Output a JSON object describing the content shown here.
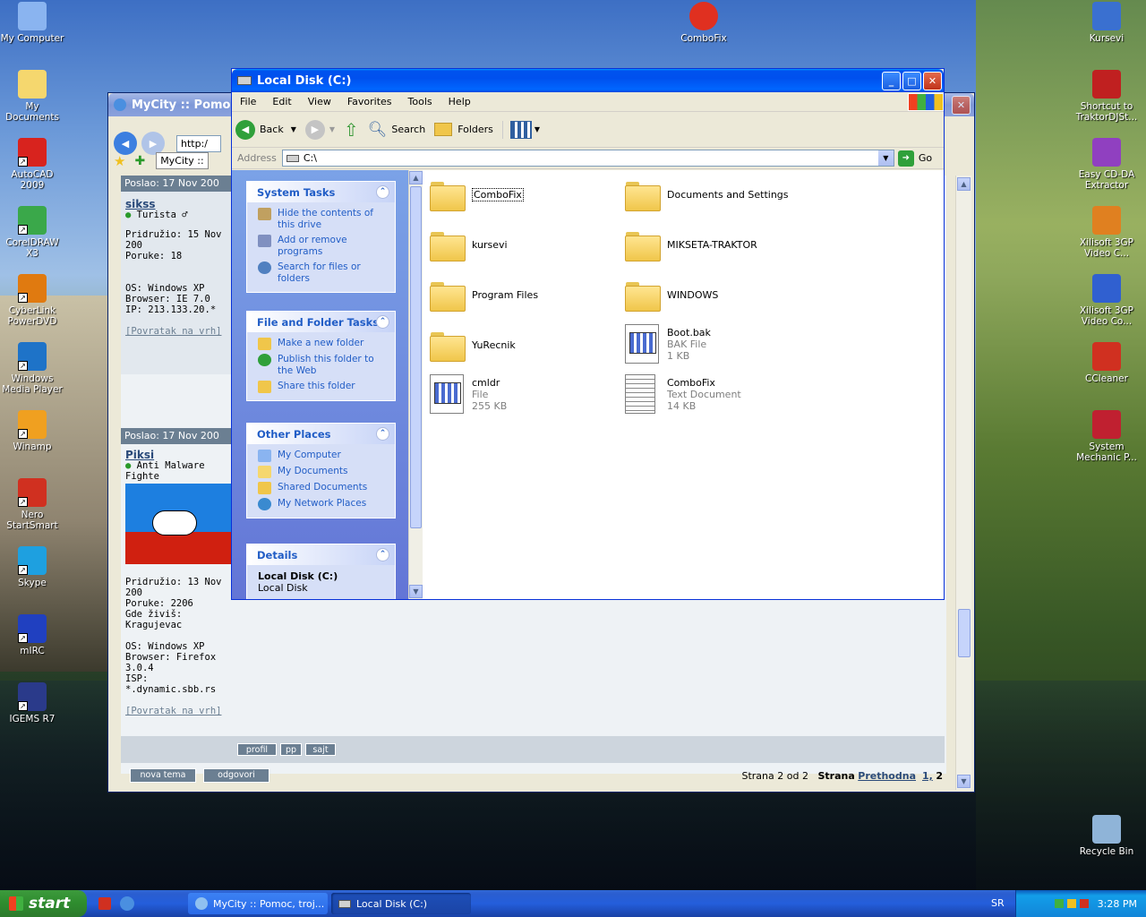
{
  "desktop": {
    "left_icons": [
      {
        "label": "My Computer",
        "icon": "computer-icon",
        "color": "#8ab4f0"
      },
      {
        "label": "My Documents",
        "icon": "documents-folder-icon",
        "color": "#f5d76e"
      },
      {
        "label": "AutoCAD 2009",
        "icon": "autocad-icon",
        "color": "#d8231e"
      },
      {
        "label": "CorelDRAW X3",
        "icon": "coreldraw-icon",
        "color": "#3aa84a"
      },
      {
        "label": "CyberLink PowerDVD",
        "icon": "powerdvd-icon",
        "color": "#e07a10"
      },
      {
        "label": "Windows Media Player",
        "icon": "media-player-icon",
        "color": "#1e73c8"
      },
      {
        "label": "Winamp",
        "icon": "winamp-icon",
        "color": "#f0a020"
      },
      {
        "label": "Nero StartSmart",
        "icon": "nero-icon",
        "color": "#d03020"
      },
      {
        "label": "Skype",
        "icon": "skype-icon",
        "color": "#1ea0e0"
      },
      {
        "label": "mIRC",
        "icon": "mirc-icon",
        "color": "#2040c0"
      },
      {
        "label": "IGEMS R7",
        "icon": "igems-icon",
        "color": "#2a3a8a"
      }
    ],
    "right_icons": [
      {
        "label": "Kursevi",
        "icon": "kursevi-icon",
        "color": "#3a70d0"
      },
      {
        "label": "Shortcut to TraktorDJSt...",
        "icon": "traktor-icon",
        "color": "#c02020"
      },
      {
        "label": "Easy CD-DA Extractor",
        "icon": "cd-extractor-icon",
        "color": "#9040c0"
      },
      {
        "label": "Xilisoft 3GP Video C...",
        "icon": "xilisoft-icon",
        "color": "#e08020"
      },
      {
        "label": "Xilisoft 3GP Video Co...",
        "icon": "xilisoft-icon-2",
        "color": "#3060d0"
      },
      {
        "label": "CCleaner",
        "icon": "ccleaner-icon",
        "color": "#d03020"
      },
      {
        "label": "System Mechanic P...",
        "icon": "system-mechanic-icon",
        "color": "#c02030"
      },
      {
        "label": "Recycle Bin",
        "icon": "recycle-bin-icon",
        "color": "#8fb4d8"
      }
    ],
    "top_icon": {
      "label": "ComboFix",
      "icon": "combofix-icon",
      "color": "#e03020"
    }
  },
  "explorer": {
    "title": "Local Disk (C:)",
    "menu": [
      "File",
      "Edit",
      "View",
      "Favorites",
      "Tools",
      "Help"
    ],
    "toolbar": {
      "back": "Back",
      "search": "Search",
      "folders": "Folders"
    },
    "address_label": "Address",
    "address_value": "C:\\",
    "go_label": "Go",
    "tasks": {
      "system": {
        "title": "System Tasks",
        "items": [
          "Hide the contents of this drive",
          "Add or remove programs",
          "Search for files or folders"
        ]
      },
      "file_folder": {
        "title": "File and Folder Tasks",
        "items": [
          "Make a new folder",
          "Publish this folder to the Web",
          "Share this folder"
        ]
      },
      "other": {
        "title": "Other Places",
        "items": [
          "My Computer",
          "My Documents",
          "Shared Documents",
          "My Network Places"
        ]
      },
      "details": {
        "title": "Details",
        "name": "Local Disk (C:)",
        "type": "Local Disk"
      }
    },
    "files": [
      {
        "name": "ComboFix"
      },
      {
        "name": "Documents and Settings"
      },
      {
        "name": "kursevi"
      },
      {
        "name": "MIKSETA-TRAKTOR"
      },
      {
        "name": "Program Files"
      },
      {
        "name": "WINDOWS"
      },
      {
        "name": "YuRecnik"
      },
      {
        "name": "Boot.bak",
        "type": "BAK File",
        "size": "1 KB"
      },
      {
        "name": "cmldr",
        "type": "File",
        "size": "255 KB"
      },
      {
        "name": "ComboFix",
        "type": "Text Document",
        "size": "14 KB"
      }
    ]
  },
  "browser": {
    "title": "MyCity :: Pomoc , t",
    "address": "http:/",
    "tab": "MyCity ::",
    "post1": {
      "header": "Poslao: 17 Nov 200",
      "user": "sikss",
      "rank": "Turista ♂",
      "joined": "Pridružio: 15 Nov 200",
      "posts": "Poruke: 18",
      "os": "OS: Windows XP",
      "browser": "Browser: IE 7.0",
      "ip": "IP: 213.133.20.*",
      "top_link": "[Povratak na vrh]"
    },
    "post2": {
      "header": "Poslao: 17 Nov 200",
      "user": "Piksi",
      "rank": "Anti Malware Fighte",
      "joined": "Pridružio: 13 Nov 200",
      "posts": "Poruke: 2206",
      "location": "Gde živiš: Kragujevac",
      "os": "OS: Windows XP",
      "browser": "Browser: Firefox 3.0.4",
      "isp": "ISP: *.dynamic.sbb.rs",
      "top_link": "[Povratak na vrh]"
    },
    "buttons": {
      "profil": "profil",
      "pp": "pp",
      "sajt": "sajt",
      "nova_tema": "nova tema",
      "odgovori": "odgovori"
    },
    "pager": {
      "page_info": "Strana 2 od 2",
      "strana": "Strana",
      "prev": "Prethodna",
      "p1": "1,",
      "p2": "2"
    }
  },
  "taskbar": {
    "start": "start",
    "tasks": [
      "MyCity :: Pomoc, troj...",
      "Local Disk (C:)"
    ],
    "lang": "SR",
    "clock": "3:28 PM"
  }
}
